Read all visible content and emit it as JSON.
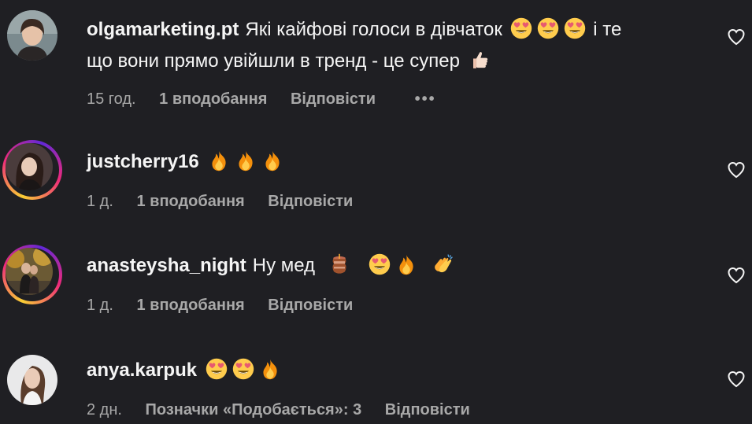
{
  "comments": [
    {
      "username": "olgamarketing.pt",
      "text_a": "Які кайфові голоси в дівчаток",
      "text_b": "і те",
      "text_c": "що вони прямо увійшли в тренд - це супер",
      "emojis": [
        "heart-eyes",
        "heart-eyes",
        "heart-eyes",
        "thumbs-up"
      ],
      "time": "15 год.",
      "likes": "1 вподобання",
      "reply": "Відповісти",
      "more": "•••",
      "has_story_ring": false
    },
    {
      "username": "justcherry16",
      "emojis": [
        "fire",
        "fire",
        "fire"
      ],
      "time": "1 д.",
      "likes": "1 вподобання",
      "reply": "Відповісти",
      "has_story_ring": true
    },
    {
      "username": "anasteysha_night",
      "text_a": "Ну мед",
      "emojis": [
        "honey-pot",
        "heart-eyes",
        "fire",
        "clapping-hands"
      ],
      "time": "1 д.",
      "likes": "1 вподобання",
      "reply": "Відповісти",
      "has_story_ring": true
    },
    {
      "username": "anya.karpuk",
      "emojis": [
        "heart-eyes",
        "heart-eyes",
        "fire"
      ],
      "time": "2 дн.",
      "likes": "Позначки «Подобається»: 3",
      "reply": "Відповісти",
      "has_story_ring": false
    }
  ],
  "icons": {
    "like": "heart-outline-icon",
    "more": "more-options-icon"
  },
  "colors": {
    "background": "#1f1f23",
    "text": "#f5f5f5",
    "meta_text": "#a8a8a8",
    "story_ring": [
      "#f9ce34",
      "#ee2a7b",
      "#6228d7"
    ]
  }
}
